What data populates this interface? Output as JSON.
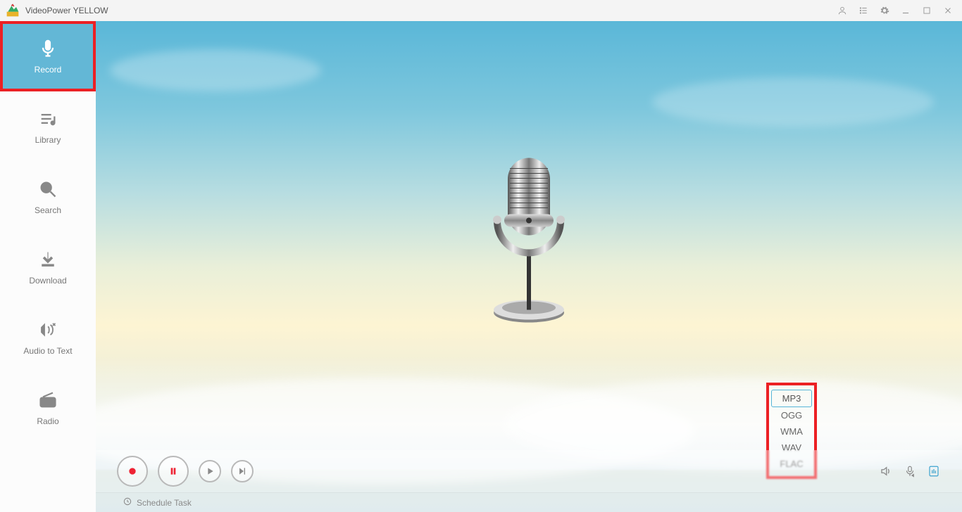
{
  "app": {
    "title": "VideoPower YELLOW"
  },
  "sidebar": {
    "items": [
      {
        "label": "Record",
        "active": true
      },
      {
        "label": "Library",
        "active": false
      },
      {
        "label": "Search",
        "active": false
      },
      {
        "label": "Download",
        "active": false
      },
      {
        "label": "Audio to Text",
        "active": false
      },
      {
        "label": "Radio",
        "active": false
      }
    ]
  },
  "format_menu": {
    "options": [
      "MP3",
      "OGG",
      "WMA",
      "WAV",
      "FLAC"
    ],
    "selected": "MP3"
  },
  "footer": {
    "schedule_label": "Schedule Task"
  },
  "titlebar_icons": {
    "account": "account-icon",
    "feedback": "list-icon",
    "settings": "gear-icon",
    "minimize": "minimize-icon",
    "maximize": "maximize-icon",
    "close": "close-icon"
  },
  "toolbar": {
    "record": "record",
    "pause": "pause",
    "play": "play",
    "next": "next",
    "speaker": "speaker",
    "mic_settings": "mic-settings",
    "format": "format"
  }
}
